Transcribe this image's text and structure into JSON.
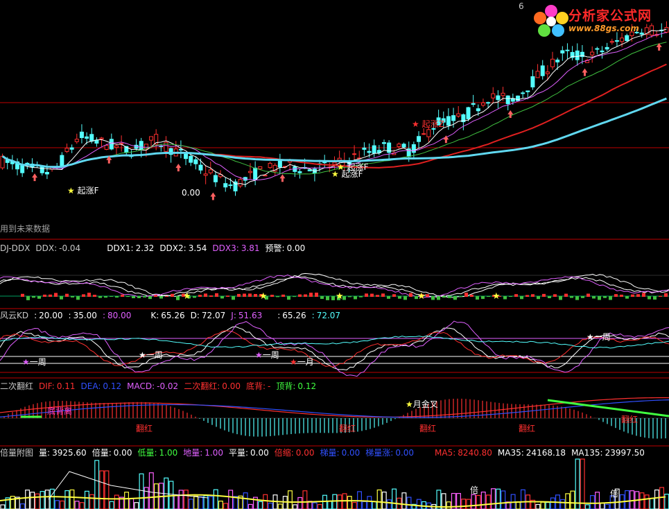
{
  "colors": {
    "background": "#000000",
    "divider": "#c00000",
    "up": "#ff3030",
    "down": "#54ffff",
    "ma_red": "#e02020",
    "ma_cyan": "#60d8f0",
    "ma_white": "#ffffff",
    "ma_magenta": "#e060ff",
    "ma_green": "#40c040",
    "star_yellow": "#ffff40",
    "star_red": "#ff3030",
    "label_yellow": "#ffff60"
  },
  "logo": {
    "title": "分析家公式网",
    "url": "www.88gs.com",
    "icon": "flower-logo-icon"
  },
  "main_panel": {
    "annotations": {
      "qizhang_f": "起涨F",
      "qizhang_z": "起涨Z",
      "qizhang_f2": "起涨F",
      "qizhang_f3": "起涨F",
      "price_low": "0.00",
      "price_top": "6"
    },
    "future_data_note": "用到未来数据"
  },
  "ddx_panel": {
    "name": "DJ-DDX",
    "fields": [
      {
        "label": "DDX:",
        "value": "-0.04",
        "color": "#c8c8c8"
      },
      {
        "label": "DDX1:",
        "value": "2.32",
        "color": "#ffffff"
      },
      {
        "label": "DDX2:",
        "value": "3.54",
        "color": "#ffffff"
      },
      {
        "label": "DDX3:",
        "value": "3.81",
        "color": "#e060ff"
      },
      {
        "label": "预警:",
        "value": "0.00",
        "color": "#ffffff"
      }
    ]
  },
  "kd_panel": {
    "name": "风云KD",
    "fields": [
      {
        "label": ":",
        "value": "20.00",
        "color": "#ffffff"
      },
      {
        "label": ":",
        "value": "35.00",
        "color": "#ffffff"
      },
      {
        "label": ":",
        "value": "80.00",
        "color": "#e060ff"
      },
      {
        "label": "K:",
        "value": "65.26",
        "color": "#ffffff"
      },
      {
        "label": "D:",
        "value": "72.07",
        "color": "#ffffff"
      },
      {
        "label": "J:",
        "value": "51.63",
        "color": "#e060ff"
      },
      {
        "label": ":",
        "value": "65.26",
        "color": "#ffffff"
      },
      {
        "label": ":",
        "value": "72.07",
        "color": "#54ffff"
      }
    ],
    "annotations": {
      "week1": "一周",
      "week2": "一周",
      "week3": "一周",
      "month1": "一月",
      "week4": "一周"
    }
  },
  "macd_panel": {
    "name": "二次翻红",
    "fields": [
      {
        "label": "DIF:",
        "value": "0.11",
        "color": "#ff3030"
      },
      {
        "label": "DEA:",
        "value": "0.12",
        "color": "#3050ff"
      },
      {
        "label": "MACD:",
        "value": "-0.02",
        "color": "#e060ff"
      },
      {
        "label": "二次翻红:",
        "value": "0.00",
        "color": "#ff3030"
      },
      {
        "label": "底背:",
        "value": "-",
        "color": "#ff3030"
      },
      {
        "label": "顶背:",
        "value": "0.12",
        "color": "#40ff40"
      }
    ],
    "annotations": {
      "dibeili": "底背离",
      "fanhong1": "翻红",
      "fanhong2": "翻红",
      "fanhong3": "翻红",
      "fanhong4": "翻红",
      "fanhong5": "翻红",
      "monthly_cross": "月金叉"
    }
  },
  "volume_panel": {
    "name": "倍量附图",
    "fields": [
      {
        "label": "量:",
        "value": "3925.60",
        "color": "#ffffff"
      },
      {
        "label": "倍量:",
        "value": "0.00",
        "color": "#ffffff"
      },
      {
        "label": "低量:",
        "value": "1.00",
        "color": "#40ff40"
      },
      {
        "label": "地量:",
        "value": "1.00",
        "color": "#e060ff"
      },
      {
        "label": "平量:",
        "value": "0.00",
        "color": "#ffffff"
      },
      {
        "label": "倍缩:",
        "value": "0.00",
        "color": "#ff3030"
      },
      {
        "label": "梯量:",
        "value": "0.00",
        "color": "#3050ff"
      },
      {
        "label": "梯量涨:",
        "value": "0.00",
        "color": "#3050ff"
      },
      {
        "label": "MA5:",
        "value": "8240.80",
        "color": "#ff3030"
      },
      {
        "label": "MA35:",
        "value": "24168.18",
        "color": "#ffffff"
      },
      {
        "label": "MA135:",
        "value": "23997.50",
        "color": "#ffffff"
      }
    ],
    "annotations": {
      "bei1": "倍",
      "bei2": "倍"
    }
  },
  "chart_data": {
    "type": "candlestick",
    "title": "",
    "candles_approx": [
      {
        "o": 6.4,
        "h": 6.6,
        "l": 6.0,
        "c": 6.1
      },
      {
        "o": 6.1,
        "h": 6.3,
        "l": 5.8,
        "c": 5.9
      },
      {
        "o": 5.9,
        "h": 6.0,
        "l": 5.7,
        "c": 5.8
      },
      {
        "o": 5.8,
        "h": 6.9,
        "l": 5.8,
        "c": 6.8
      },
      {
        "o": 6.8,
        "h": 7.2,
        "l": 6.5,
        "c": 6.6
      },
      {
        "o": 6.6,
        "h": 6.9,
        "l": 6.3,
        "c": 6.4
      },
      {
        "o": 6.4,
        "h": 6.8,
        "l": 6.3,
        "c": 6.7
      },
      {
        "o": 6.7,
        "h": 6.9,
        "l": 6.2,
        "c": 6.3
      },
      {
        "o": 6.3,
        "h": 6.4,
        "l": 5.7,
        "c": 5.8
      },
      {
        "o": 5.8,
        "h": 5.9,
        "l": 5.3,
        "c": 5.4
      },
      {
        "o": 5.4,
        "h": 5.9,
        "l": 5.3,
        "c": 5.8
      },
      {
        "o": 5.8,
        "h": 6.1,
        "l": 5.7,
        "c": 6.0
      },
      {
        "o": 6.0,
        "h": 6.2,
        "l": 5.8,
        "c": 5.9
      },
      {
        "o": 5.9,
        "h": 6.1,
        "l": 5.8,
        "c": 6.0
      },
      {
        "o": 6.0,
        "h": 6.4,
        "l": 5.9,
        "c": 6.3
      },
      {
        "o": 6.3,
        "h": 6.6,
        "l": 6.2,
        "c": 6.5
      },
      {
        "o": 6.5,
        "h": 6.6,
        "l": 6.3,
        "c": 6.4
      },
      {
        "o": 6.4,
        "h": 7.4,
        "l": 6.4,
        "c": 7.2
      },
      {
        "o": 7.2,
        "h": 7.6,
        "l": 7.0,
        "c": 7.3
      },
      {
        "o": 7.3,
        "h": 8.0,
        "l": 7.2,
        "c": 7.9
      },
      {
        "o": 7.9,
        "h": 8.2,
        "l": 7.7,
        "c": 7.8
      },
      {
        "o": 7.8,
        "h": 8.6,
        "l": 7.7,
        "c": 8.5
      },
      {
        "o": 8.5,
        "h": 9.2,
        "l": 8.4,
        "c": 9.1
      },
      {
        "o": 9.1,
        "h": 9.6,
        "l": 8.8,
        "c": 9.0
      },
      {
        "o": 9.0,
        "h": 9.5,
        "l": 8.7,
        "c": 9.4
      },
      {
        "o": 9.4,
        "h": 10.0,
        "l": 9.2,
        "c": 9.8
      },
      {
        "o": 9.8,
        "h": 10.1,
        "l": 9.6,
        "c": 9.7
      }
    ],
    "ma_series": [
      {
        "name": "",
        "color": "#e02020"
      },
      {
        "name": "",
        "color": "#60d8f0"
      },
      {
        "name": "",
        "color": "#ffffff"
      },
      {
        "name": "",
        "color": "#e060ff"
      },
      {
        "name": "",
        "color": "#40c040"
      }
    ]
  }
}
